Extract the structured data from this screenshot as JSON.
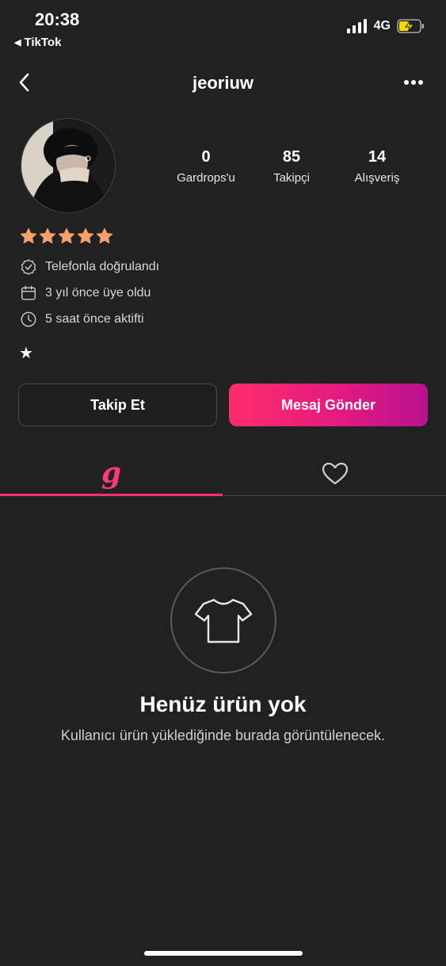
{
  "status_bar": {
    "time": "20:38",
    "back_app": "TikTok",
    "carrier": "4G"
  },
  "nav": {
    "title": "jeoriuw"
  },
  "profile": {
    "stats": [
      {
        "value": "0",
        "label": "Gardrops'u"
      },
      {
        "value": "85",
        "label": "Takipçi"
      },
      {
        "value": "14",
        "label": "Alışveriş"
      }
    ],
    "rating_stars": 5,
    "star_color": "#f6a06b",
    "info": [
      {
        "icon": "verified-check-icon",
        "text": "Telefonla doğrulandı"
      },
      {
        "icon": "calendar-icon",
        "text": "3 yıl önce üye oldu"
      },
      {
        "icon": "clock-icon",
        "text": "5 saat önce aktifti"
      }
    ],
    "bio_symbol": "★"
  },
  "actions": {
    "follow_label": "Takip Et",
    "message_label": "Mesaj Gönder"
  },
  "tabs": {
    "wardrobe_glyph": "g",
    "accent": "#ff2f6e"
  },
  "empty_state": {
    "title": "Henüz ürün yok",
    "subtitle": "Kullanıcı ürün yüklediğinde burada görüntülenecek."
  }
}
